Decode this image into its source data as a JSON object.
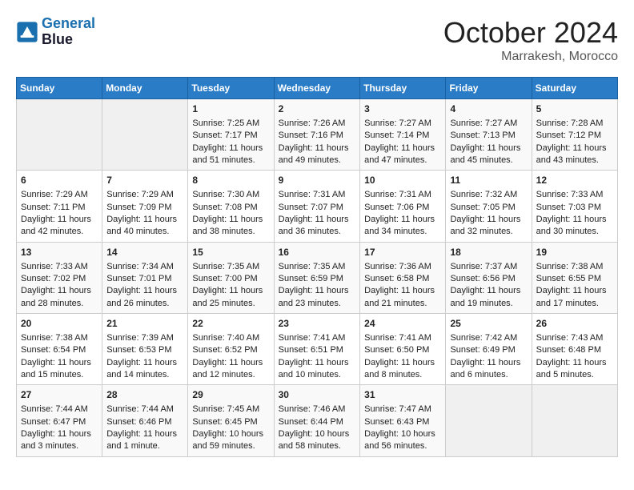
{
  "header": {
    "logo_line1": "General",
    "logo_line2": "Blue",
    "month": "October 2024",
    "location": "Marrakesh, Morocco"
  },
  "days_of_week": [
    "Sunday",
    "Monday",
    "Tuesday",
    "Wednesday",
    "Thursday",
    "Friday",
    "Saturday"
  ],
  "weeks": [
    [
      {
        "day": "",
        "info": ""
      },
      {
        "day": "",
        "info": ""
      },
      {
        "day": "1",
        "info": "Sunrise: 7:25 AM\nSunset: 7:17 PM\nDaylight: 11 hours and 51 minutes."
      },
      {
        "day": "2",
        "info": "Sunrise: 7:26 AM\nSunset: 7:16 PM\nDaylight: 11 hours and 49 minutes."
      },
      {
        "day": "3",
        "info": "Sunrise: 7:27 AM\nSunset: 7:14 PM\nDaylight: 11 hours and 47 minutes."
      },
      {
        "day": "4",
        "info": "Sunrise: 7:27 AM\nSunset: 7:13 PM\nDaylight: 11 hours and 45 minutes."
      },
      {
        "day": "5",
        "info": "Sunrise: 7:28 AM\nSunset: 7:12 PM\nDaylight: 11 hours and 43 minutes."
      }
    ],
    [
      {
        "day": "6",
        "info": "Sunrise: 7:29 AM\nSunset: 7:11 PM\nDaylight: 11 hours and 42 minutes."
      },
      {
        "day": "7",
        "info": "Sunrise: 7:29 AM\nSunset: 7:09 PM\nDaylight: 11 hours and 40 minutes."
      },
      {
        "day": "8",
        "info": "Sunrise: 7:30 AM\nSunset: 7:08 PM\nDaylight: 11 hours and 38 minutes."
      },
      {
        "day": "9",
        "info": "Sunrise: 7:31 AM\nSunset: 7:07 PM\nDaylight: 11 hours and 36 minutes."
      },
      {
        "day": "10",
        "info": "Sunrise: 7:31 AM\nSunset: 7:06 PM\nDaylight: 11 hours and 34 minutes."
      },
      {
        "day": "11",
        "info": "Sunrise: 7:32 AM\nSunset: 7:05 PM\nDaylight: 11 hours and 32 minutes."
      },
      {
        "day": "12",
        "info": "Sunrise: 7:33 AM\nSunset: 7:03 PM\nDaylight: 11 hours and 30 minutes."
      }
    ],
    [
      {
        "day": "13",
        "info": "Sunrise: 7:33 AM\nSunset: 7:02 PM\nDaylight: 11 hours and 28 minutes."
      },
      {
        "day": "14",
        "info": "Sunrise: 7:34 AM\nSunset: 7:01 PM\nDaylight: 11 hours and 26 minutes."
      },
      {
        "day": "15",
        "info": "Sunrise: 7:35 AM\nSunset: 7:00 PM\nDaylight: 11 hours and 25 minutes."
      },
      {
        "day": "16",
        "info": "Sunrise: 7:35 AM\nSunset: 6:59 PM\nDaylight: 11 hours and 23 minutes."
      },
      {
        "day": "17",
        "info": "Sunrise: 7:36 AM\nSunset: 6:58 PM\nDaylight: 11 hours and 21 minutes."
      },
      {
        "day": "18",
        "info": "Sunrise: 7:37 AM\nSunset: 6:56 PM\nDaylight: 11 hours and 19 minutes."
      },
      {
        "day": "19",
        "info": "Sunrise: 7:38 AM\nSunset: 6:55 PM\nDaylight: 11 hours and 17 minutes."
      }
    ],
    [
      {
        "day": "20",
        "info": "Sunrise: 7:38 AM\nSunset: 6:54 PM\nDaylight: 11 hours and 15 minutes."
      },
      {
        "day": "21",
        "info": "Sunrise: 7:39 AM\nSunset: 6:53 PM\nDaylight: 11 hours and 14 minutes."
      },
      {
        "day": "22",
        "info": "Sunrise: 7:40 AM\nSunset: 6:52 PM\nDaylight: 11 hours and 12 minutes."
      },
      {
        "day": "23",
        "info": "Sunrise: 7:41 AM\nSunset: 6:51 PM\nDaylight: 11 hours and 10 minutes."
      },
      {
        "day": "24",
        "info": "Sunrise: 7:41 AM\nSunset: 6:50 PM\nDaylight: 11 hours and 8 minutes."
      },
      {
        "day": "25",
        "info": "Sunrise: 7:42 AM\nSunset: 6:49 PM\nDaylight: 11 hours and 6 minutes."
      },
      {
        "day": "26",
        "info": "Sunrise: 7:43 AM\nSunset: 6:48 PM\nDaylight: 11 hours and 5 minutes."
      }
    ],
    [
      {
        "day": "27",
        "info": "Sunrise: 7:44 AM\nSunset: 6:47 PM\nDaylight: 11 hours and 3 minutes."
      },
      {
        "day": "28",
        "info": "Sunrise: 7:44 AM\nSunset: 6:46 PM\nDaylight: 11 hours and 1 minute."
      },
      {
        "day": "29",
        "info": "Sunrise: 7:45 AM\nSunset: 6:45 PM\nDaylight: 10 hours and 59 minutes."
      },
      {
        "day": "30",
        "info": "Sunrise: 7:46 AM\nSunset: 6:44 PM\nDaylight: 10 hours and 58 minutes."
      },
      {
        "day": "31",
        "info": "Sunrise: 7:47 AM\nSunset: 6:43 PM\nDaylight: 10 hours and 56 minutes."
      },
      {
        "day": "",
        "info": ""
      },
      {
        "day": "",
        "info": ""
      }
    ]
  ]
}
